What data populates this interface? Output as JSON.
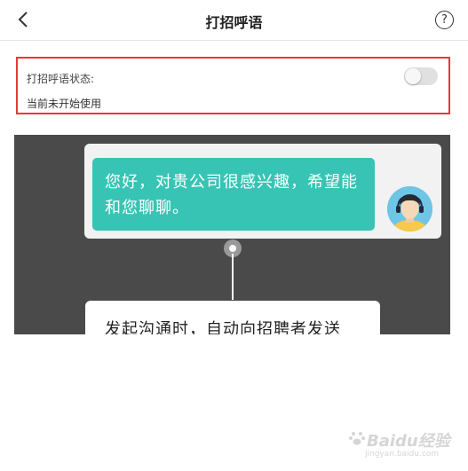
{
  "header": {
    "title": "打招呼语"
  },
  "status": {
    "label": "打招呼语状态:",
    "note": "当前未开始使用",
    "enabled": false
  },
  "preview": {
    "bubble_text": "您好，对贵公司很感兴趣，希望能和您聊聊。",
    "caption": "发起沟通时，自动向招聘者发送"
  },
  "watermark": {
    "brand": "Baidu经验",
    "url": "jingyan.baidu.com"
  },
  "colors": {
    "highlight": "#e53935",
    "bubble": "#38c4b4",
    "preview_bg": "#4a4a4a"
  }
}
